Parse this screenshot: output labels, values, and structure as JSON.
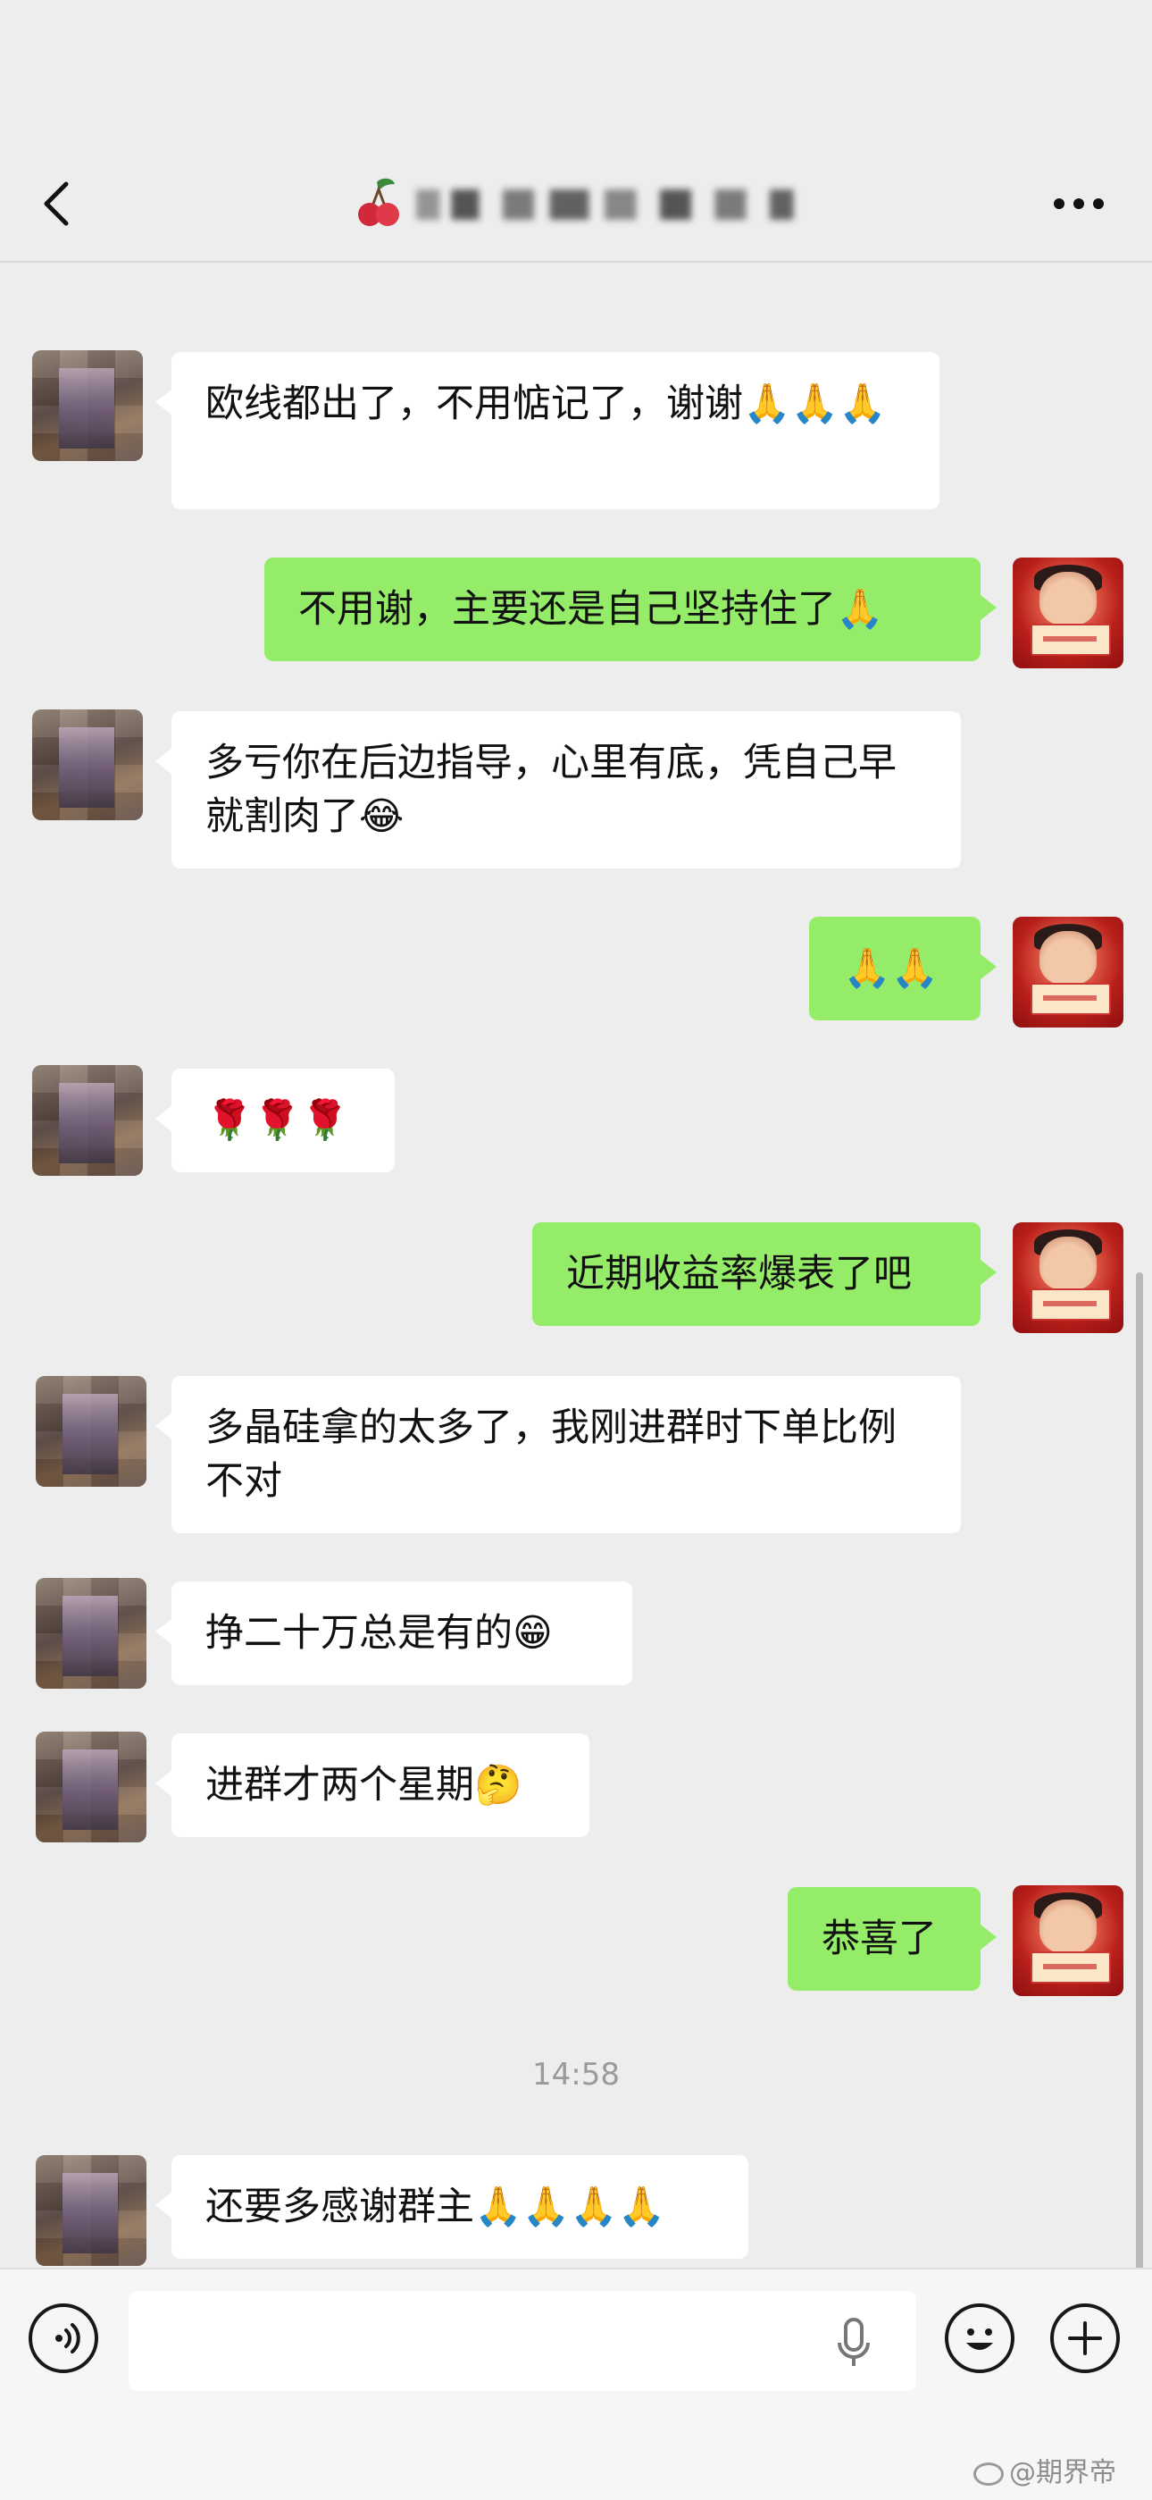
{
  "header": {
    "title": "",
    "back_icon": "chevron-left-icon",
    "more_icon": "more-dots-icon"
  },
  "messages": [
    {
      "side": "left",
      "text": "欧线都出了，不用惦记了，谢谢🙏🙏🙏"
    },
    {
      "side": "right",
      "text": "不用谢，主要还是自己坚持住了🙏"
    },
    {
      "side": "left",
      "text": "多亏你在后边指导，心里有底，凭自己早就割肉了😂"
    },
    {
      "side": "right",
      "text": "🙏🙏"
    },
    {
      "side": "left",
      "text": "🌹🌹🌹"
    },
    {
      "side": "right",
      "text": "近期收益率爆表了吧"
    },
    {
      "side": "left",
      "text": "多晶硅拿的太多了，我刚进群时下单比例不对"
    },
    {
      "side": "left",
      "text": "挣二十万总是有的😁"
    },
    {
      "side": "left",
      "text": "进群才两个星期🤔"
    },
    {
      "side": "right",
      "text": "恭喜了"
    },
    {
      "side": "left",
      "text": "还要多感谢群主🙏🙏🙏🙏"
    }
  ],
  "timestamp": "14:58",
  "input": {
    "voice_icon": "voice-icon",
    "mic_icon": "microphone-icon",
    "emoji_icon": "emoji-icon",
    "plus_icon": "plus-icon",
    "value": ""
  },
  "watermark": "@期界帝",
  "colors": {
    "background": "#ededed",
    "bubble_self": "#95ec69",
    "bubble_other": "#ffffff"
  }
}
